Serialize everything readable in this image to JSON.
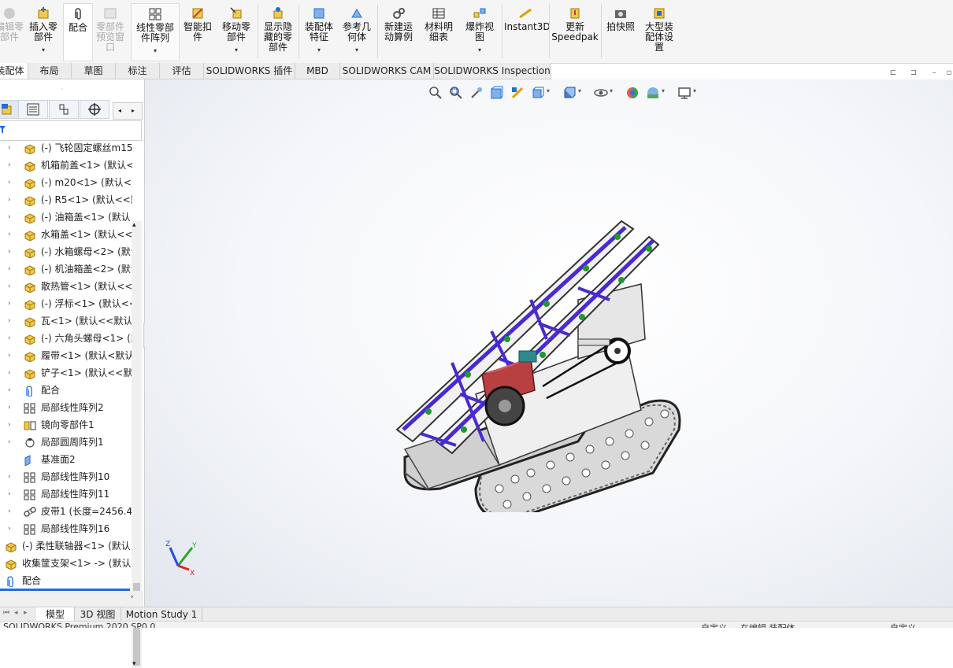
{
  "ribbon": {
    "edit_component": "编辑零\n部件",
    "insert_component": "插入零\n部件",
    "mate": "配合",
    "component_preview": "零部件\n预览窗\n口",
    "linear_pattern": "线性零部\n件阵列",
    "smart_fasteners": "智能扣\n件",
    "move_component": "移动零\n部件",
    "show_hidden": "显示隐\n藏的零\n部件",
    "assembly_features": "装配体\n特征",
    "reference_geometry": "参考几\n何体",
    "new_motion_study": "新建运\n动算例",
    "bill_of_materials": "材料明\n细表",
    "exploded_view": "爆炸视\n图",
    "instant3d": "Instant3D",
    "update_speedpak": "更新\nSpeedpak",
    "take_snapshot": "拍快照",
    "large_assembly_settings": "大型装\n配体设\n置"
  },
  "tabs": [
    "装配体",
    "布局",
    "草图",
    "标注",
    "评估",
    "SOLIDWORKS 插件",
    "MBD",
    "SOLIDWORKS CAM",
    "SOLIDWORKS Inspection"
  ],
  "tree": {
    "items": [
      {
        "label": "(-) 飞轮固定螺丝m15",
        "icon": "part"
      },
      {
        "label": "机箱前盖<1> (默认<",
        "icon": "part"
      },
      {
        "label": "(-) m20<1> (默认<<",
        "icon": "part"
      },
      {
        "label": "(-) R5<1> (默认<<默",
        "icon": "part"
      },
      {
        "label": "(-) 油箱盖<1> (默认",
        "icon": "part"
      },
      {
        "label": "水箱盖<1> (默认<<默",
        "icon": "part"
      },
      {
        "label": "(-) 水箱螺母<2> (默认",
        "icon": "part"
      },
      {
        "label": "(-) 机油箱盖<2> (默认",
        "icon": "part"
      },
      {
        "label": "散热管<1> (默认<<默",
        "icon": "part"
      },
      {
        "label": "(-) 浮标<1> (默认<<",
        "icon": "part"
      },
      {
        "label": "瓦<1> (默认<<默认",
        "icon": "part"
      },
      {
        "label": "(-) 六角头螺母<1> (默",
        "icon": "part"
      },
      {
        "label": "履带<1> (默认<默认",
        "icon": "part"
      },
      {
        "label": "铲子<1> (默认<<默认",
        "icon": "part"
      },
      {
        "label": "配合",
        "icon": "mate"
      },
      {
        "label": "局部线性阵列2",
        "icon": "pattern"
      },
      {
        "label": "镜向零部件1",
        "icon": "mirror"
      },
      {
        "label": "局部圆周阵列1",
        "icon": "circpattern"
      },
      {
        "label": "基准面2",
        "icon": "plane"
      },
      {
        "label": "局部线性阵列10",
        "icon": "pattern"
      },
      {
        "label": "局部线性阵列11",
        "icon": "pattern"
      },
      {
        "label": "皮带1 (长度=2456.45",
        "icon": "belt"
      },
      {
        "label": "局部线性阵列16",
        "icon": "pattern"
      },
      {
        "label": "(-) 柔性联轴器<1> (默认",
        "icon": "part"
      },
      {
        "label": "收集筐支架<1> -> (默认",
        "icon": "part"
      },
      {
        "label": "配合",
        "icon": "mate"
      }
    ]
  },
  "bottom_tabs": [
    "模型",
    "3D 视图",
    "Motion Study 1"
  ],
  "status": {
    "left": "SOLIDWORKS Premium 2020 SP0.0",
    "right1": "自定义",
    "right2": "在编辑 装配体",
    "right3": "自定义"
  },
  "triad": {
    "x": "X",
    "y": "Y",
    "z": "Z"
  },
  "colors": {
    "accent": "#1e6fd9",
    "frame": "#4a2ad0",
    "engine": "#b84040",
    "sprocket": "#1f9a2c"
  }
}
